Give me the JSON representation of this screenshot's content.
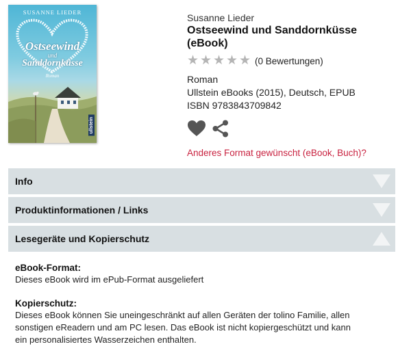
{
  "cover": {
    "author": "SUSANNE LIEDER",
    "title_line1": "Ostseewind",
    "title_line2": "und",
    "title_line3": "Sanddornküsse",
    "genre": "Roman",
    "publisher": "ullstein"
  },
  "product": {
    "author": "Susanne Lieder",
    "title": "Ostseewind und Sanddornküsse (eBook)",
    "rating_stars": 0,
    "rating_max": 5,
    "rating_count_label": "(0 Bewertungen)",
    "genre": "Roman",
    "publisher_line": "Ullstein eBooks (2015), Deutsch, EPUB",
    "isbn_line": "ISBN 9783843709842",
    "wishlist_icon": "heart-icon",
    "share_icon": "share-icon",
    "format_link": "Anderes Format gewünscht (eBook, Buch)?"
  },
  "accordion": [
    {
      "label": "Info",
      "expanded": false
    },
    {
      "label": "Produktinformationen / Links",
      "expanded": false
    },
    {
      "label": "Lesegeräte und Kopierschutz",
      "expanded": true
    }
  ],
  "expanded_content": {
    "format_title": "eBook-Format:",
    "format_text": "Dieses eBook wird im ePub-Format ausgeliefert",
    "copy_title": "Kopierschutz:",
    "copy_text_line1": "Dieses eBook können Sie uneingeschränkt auf allen Geräten der tolino Familie, allen",
    "copy_text_line2": "sonstigen eReadern und am PC lesen. Das eBook ist nicht kopiergeschützt und kann",
    "copy_text_line3": "ein personalisiertes Wasserzeichen enthalten."
  },
  "colors": {
    "accent_link": "#c8213f",
    "accordion_bg": "#d8dfe2",
    "star_empty": "#b5b5b5",
    "icon_gray": "#555555"
  }
}
